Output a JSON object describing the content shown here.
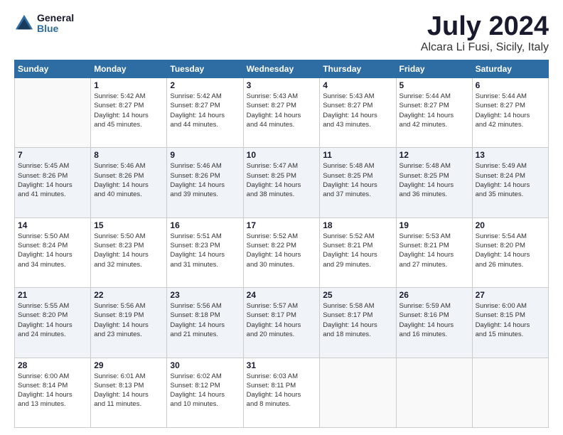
{
  "logo": {
    "general": "General",
    "blue": "Blue"
  },
  "title": "July 2024",
  "location": "Alcara Li Fusi, Sicily, Italy",
  "days_header": [
    "Sunday",
    "Monday",
    "Tuesday",
    "Wednesday",
    "Thursday",
    "Friday",
    "Saturday"
  ],
  "weeks": [
    [
      {
        "day": "",
        "info": ""
      },
      {
        "day": "1",
        "info": "Sunrise: 5:42 AM\nSunset: 8:27 PM\nDaylight: 14 hours\nand 45 minutes."
      },
      {
        "day": "2",
        "info": "Sunrise: 5:42 AM\nSunset: 8:27 PM\nDaylight: 14 hours\nand 44 minutes."
      },
      {
        "day": "3",
        "info": "Sunrise: 5:43 AM\nSunset: 8:27 PM\nDaylight: 14 hours\nand 44 minutes."
      },
      {
        "day": "4",
        "info": "Sunrise: 5:43 AM\nSunset: 8:27 PM\nDaylight: 14 hours\nand 43 minutes."
      },
      {
        "day": "5",
        "info": "Sunrise: 5:44 AM\nSunset: 8:27 PM\nDaylight: 14 hours\nand 42 minutes."
      },
      {
        "day": "6",
        "info": "Sunrise: 5:44 AM\nSunset: 8:27 PM\nDaylight: 14 hours\nand 42 minutes."
      }
    ],
    [
      {
        "day": "7",
        "info": "Sunrise: 5:45 AM\nSunset: 8:26 PM\nDaylight: 14 hours\nand 41 minutes."
      },
      {
        "day": "8",
        "info": "Sunrise: 5:46 AM\nSunset: 8:26 PM\nDaylight: 14 hours\nand 40 minutes."
      },
      {
        "day": "9",
        "info": "Sunrise: 5:46 AM\nSunset: 8:26 PM\nDaylight: 14 hours\nand 39 minutes."
      },
      {
        "day": "10",
        "info": "Sunrise: 5:47 AM\nSunset: 8:25 PM\nDaylight: 14 hours\nand 38 minutes."
      },
      {
        "day": "11",
        "info": "Sunrise: 5:48 AM\nSunset: 8:25 PM\nDaylight: 14 hours\nand 37 minutes."
      },
      {
        "day": "12",
        "info": "Sunrise: 5:48 AM\nSunset: 8:25 PM\nDaylight: 14 hours\nand 36 minutes."
      },
      {
        "day": "13",
        "info": "Sunrise: 5:49 AM\nSunset: 8:24 PM\nDaylight: 14 hours\nand 35 minutes."
      }
    ],
    [
      {
        "day": "14",
        "info": "Sunrise: 5:50 AM\nSunset: 8:24 PM\nDaylight: 14 hours\nand 34 minutes."
      },
      {
        "day": "15",
        "info": "Sunrise: 5:50 AM\nSunset: 8:23 PM\nDaylight: 14 hours\nand 32 minutes."
      },
      {
        "day": "16",
        "info": "Sunrise: 5:51 AM\nSunset: 8:23 PM\nDaylight: 14 hours\nand 31 minutes."
      },
      {
        "day": "17",
        "info": "Sunrise: 5:52 AM\nSunset: 8:22 PM\nDaylight: 14 hours\nand 30 minutes."
      },
      {
        "day": "18",
        "info": "Sunrise: 5:52 AM\nSunset: 8:21 PM\nDaylight: 14 hours\nand 29 minutes."
      },
      {
        "day": "19",
        "info": "Sunrise: 5:53 AM\nSunset: 8:21 PM\nDaylight: 14 hours\nand 27 minutes."
      },
      {
        "day": "20",
        "info": "Sunrise: 5:54 AM\nSunset: 8:20 PM\nDaylight: 14 hours\nand 26 minutes."
      }
    ],
    [
      {
        "day": "21",
        "info": "Sunrise: 5:55 AM\nSunset: 8:20 PM\nDaylight: 14 hours\nand 24 minutes."
      },
      {
        "day": "22",
        "info": "Sunrise: 5:56 AM\nSunset: 8:19 PM\nDaylight: 14 hours\nand 23 minutes."
      },
      {
        "day": "23",
        "info": "Sunrise: 5:56 AM\nSunset: 8:18 PM\nDaylight: 14 hours\nand 21 minutes."
      },
      {
        "day": "24",
        "info": "Sunrise: 5:57 AM\nSunset: 8:17 PM\nDaylight: 14 hours\nand 20 minutes."
      },
      {
        "day": "25",
        "info": "Sunrise: 5:58 AM\nSunset: 8:17 PM\nDaylight: 14 hours\nand 18 minutes."
      },
      {
        "day": "26",
        "info": "Sunrise: 5:59 AM\nSunset: 8:16 PM\nDaylight: 14 hours\nand 16 minutes."
      },
      {
        "day": "27",
        "info": "Sunrise: 6:00 AM\nSunset: 8:15 PM\nDaylight: 14 hours\nand 15 minutes."
      }
    ],
    [
      {
        "day": "28",
        "info": "Sunrise: 6:00 AM\nSunset: 8:14 PM\nDaylight: 14 hours\nand 13 minutes."
      },
      {
        "day": "29",
        "info": "Sunrise: 6:01 AM\nSunset: 8:13 PM\nDaylight: 14 hours\nand 11 minutes."
      },
      {
        "day": "30",
        "info": "Sunrise: 6:02 AM\nSunset: 8:12 PM\nDaylight: 14 hours\nand 10 minutes."
      },
      {
        "day": "31",
        "info": "Sunrise: 6:03 AM\nSunset: 8:11 PM\nDaylight: 14 hours\nand 8 minutes."
      },
      {
        "day": "",
        "info": ""
      },
      {
        "day": "",
        "info": ""
      },
      {
        "day": "",
        "info": ""
      }
    ]
  ]
}
